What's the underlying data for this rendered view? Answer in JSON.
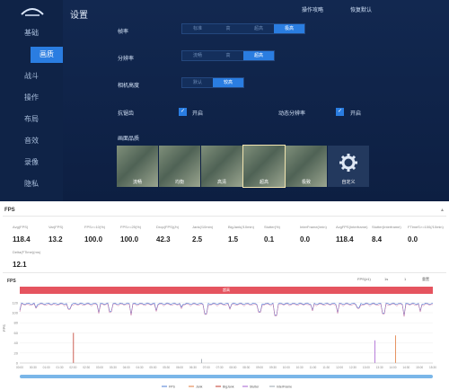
{
  "settings": {
    "title": "设置",
    "top_buttons": [
      "操作攻略",
      "恢复默认"
    ],
    "sidebar": [
      {
        "label": "基础",
        "active": false
      },
      {
        "label": "画质",
        "active": true
      },
      {
        "label": "战斗",
        "active": false
      },
      {
        "label": "操作",
        "active": false
      },
      {
        "label": "布局",
        "active": false
      },
      {
        "label": "音效",
        "active": false
      },
      {
        "label": "录像",
        "active": false
      },
      {
        "label": "隐私",
        "active": false
      }
    ],
    "rows": {
      "frame_rate": {
        "label": "帧率",
        "options": [
          "标准",
          "高",
          "超高",
          "极高"
        ],
        "selected": 3
      },
      "resolution": {
        "label": "分辨率",
        "options": [
          "流畅",
          "高",
          "超高"
        ],
        "selected": 2
      },
      "camera_height": {
        "label": "相机高度",
        "options": [
          "默认",
          "较高"
        ],
        "selected": 1
      }
    },
    "toggles": [
      {
        "label": "抗锯齿",
        "state": "开启"
      },
      {
        "label": "动态分辨率",
        "state": "开启"
      }
    ],
    "preset_label": "画面品质",
    "presets": [
      {
        "label": "流畅",
        "selected": false
      },
      {
        "label": "均衡",
        "selected": false
      },
      {
        "label": "高清",
        "selected": false
      },
      {
        "label": "超高",
        "selected": true
      },
      {
        "label": "极致",
        "selected": false
      },
      {
        "label": "自定义",
        "selected": false
      }
    ]
  },
  "report": {
    "section": "FPS",
    "stats": [
      {
        "key": "Avg(FPS)",
        "value": "118.4"
      },
      {
        "key": "Var(FPS)",
        "value": "13.2"
      },
      {
        "key": "FPS>=10(%)",
        "value": "100.0"
      },
      {
        "key": "FPS>=25(%)",
        "value": "100.0"
      },
      {
        "key": "Drop(FPS)(/h)",
        "value": "42.3"
      },
      {
        "key": "Jank(/10min)",
        "value": "2.5"
      },
      {
        "key": "BigJank(/10min)",
        "value": "1.5"
      },
      {
        "key": "Stutter(%)",
        "value": "0.1"
      },
      {
        "key": "InterFrame(/min)",
        "value": "0.0"
      },
      {
        "key": "AvgFPS(Interframe)",
        "value": "118.4"
      },
      {
        "key": "Stutter(Interframe)",
        "value": "8.4"
      },
      {
        "key": "FTimeS>=100(/10min)",
        "value": "0.0"
      },
      {
        "key": "Delta(FTime)(ms)",
        "value": "12.1"
      }
    ],
    "chart_title": "FPS",
    "chart_controls": [
      "FPS(≥1)",
      "1s",
      "1",
      "重置"
    ],
    "red_bar_label": "超高"
  },
  "chart_data": {
    "type": "line",
    "title": "",
    "ylabel": "FPS",
    "ylim": [
      0,
      125
    ],
    "yticks": [
      0,
      20,
      40,
      60,
      80,
      100,
      120
    ],
    "x_ticks": [
      "00:00",
      "00:30",
      "01:00",
      "01:30",
      "02:00",
      "02:30",
      "03:00",
      "03:30",
      "04:00",
      "04:30",
      "05:00",
      "05:30",
      "06:00",
      "06:30",
      "07:00",
      "07:30",
      "08:00",
      "08:30",
      "09:00",
      "09:30",
      "10:00",
      "10:30",
      "11:00",
      "11:30",
      "12:00",
      "12:30",
      "13:00",
      "13:30",
      "14:00",
      "14:30",
      "15:00",
      "15:30"
    ],
    "legend": [
      "FPS",
      "Jank",
      "BigJank",
      "Stutter",
      "InterFrame"
    ],
    "series_colors": [
      "#4b7bd6",
      "#e07a3c",
      "#c0392b",
      "#a65fd1",
      "#9aa4ad"
    ],
    "fps_baseline": 118,
    "dips": [
      {
        "x": 0.0,
        "y": 105
      },
      {
        "x": 0.04,
        "y": 110
      },
      {
        "x": 0.12,
        "y": 108
      },
      {
        "x": 0.19,
        "y": 100
      },
      {
        "x": 0.22,
        "y": 103
      },
      {
        "x": 0.27,
        "y": 96
      },
      {
        "x": 0.33,
        "y": 104
      },
      {
        "x": 0.39,
        "y": 111
      },
      {
        "x": 0.45,
        "y": 98
      },
      {
        "x": 0.51,
        "y": 108
      },
      {
        "x": 0.58,
        "y": 102
      },
      {
        "x": 0.62,
        "y": 95
      },
      {
        "x": 0.71,
        "y": 105
      },
      {
        "x": 0.77,
        "y": 100
      },
      {
        "x": 0.82,
        "y": 110
      },
      {
        "x": 0.88,
        "y": 99
      },
      {
        "x": 0.93,
        "y": 94
      },
      {
        "x": 0.97,
        "y": 103
      }
    ],
    "spikes": [
      {
        "x": 0.13,
        "y": 60,
        "color": "#c0392b"
      },
      {
        "x": 0.44,
        "y": 8,
        "color": "#9aa4ad"
      },
      {
        "x": 0.86,
        "y": 45,
        "color": "#a65fd1"
      },
      {
        "x": 0.91,
        "y": 55,
        "color": "#e07a3c"
      }
    ]
  }
}
